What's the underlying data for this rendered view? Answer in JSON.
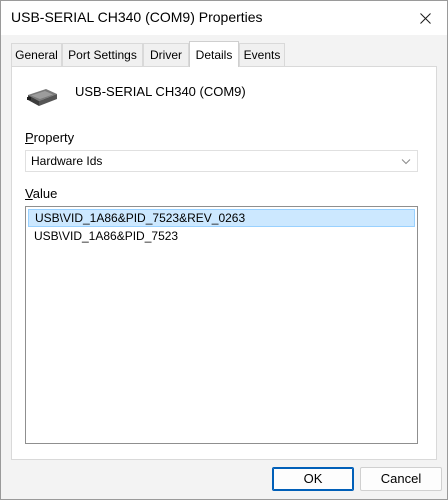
{
  "window": {
    "title": "USB-SERIAL CH340 (COM9) Properties"
  },
  "tabs": [
    {
      "label": "General",
      "active": false
    },
    {
      "label": "Port Settings",
      "active": false
    },
    {
      "label": "Driver",
      "active": false
    },
    {
      "label": "Details",
      "active": true
    },
    {
      "label": "Events",
      "active": false
    }
  ],
  "device": {
    "name": "USB-SERIAL CH340 (COM9)",
    "icon": "usb-serial-device-icon"
  },
  "property": {
    "label_access": "P",
    "label_rest": "roperty",
    "selected": "Hardware Ids"
  },
  "value": {
    "label_access": "V",
    "label_rest": "alue",
    "items": [
      "USB\\VID_1A86&PID_7523&REV_0263",
      "USB\\VID_1A86&PID_7523"
    ],
    "selected_index": 0
  },
  "buttons": {
    "ok": "OK",
    "cancel": "Cancel"
  },
  "colors": {
    "accent": "#005fb8",
    "selection_bg": "#cce8ff",
    "selection_border": "#99d1ff"
  }
}
